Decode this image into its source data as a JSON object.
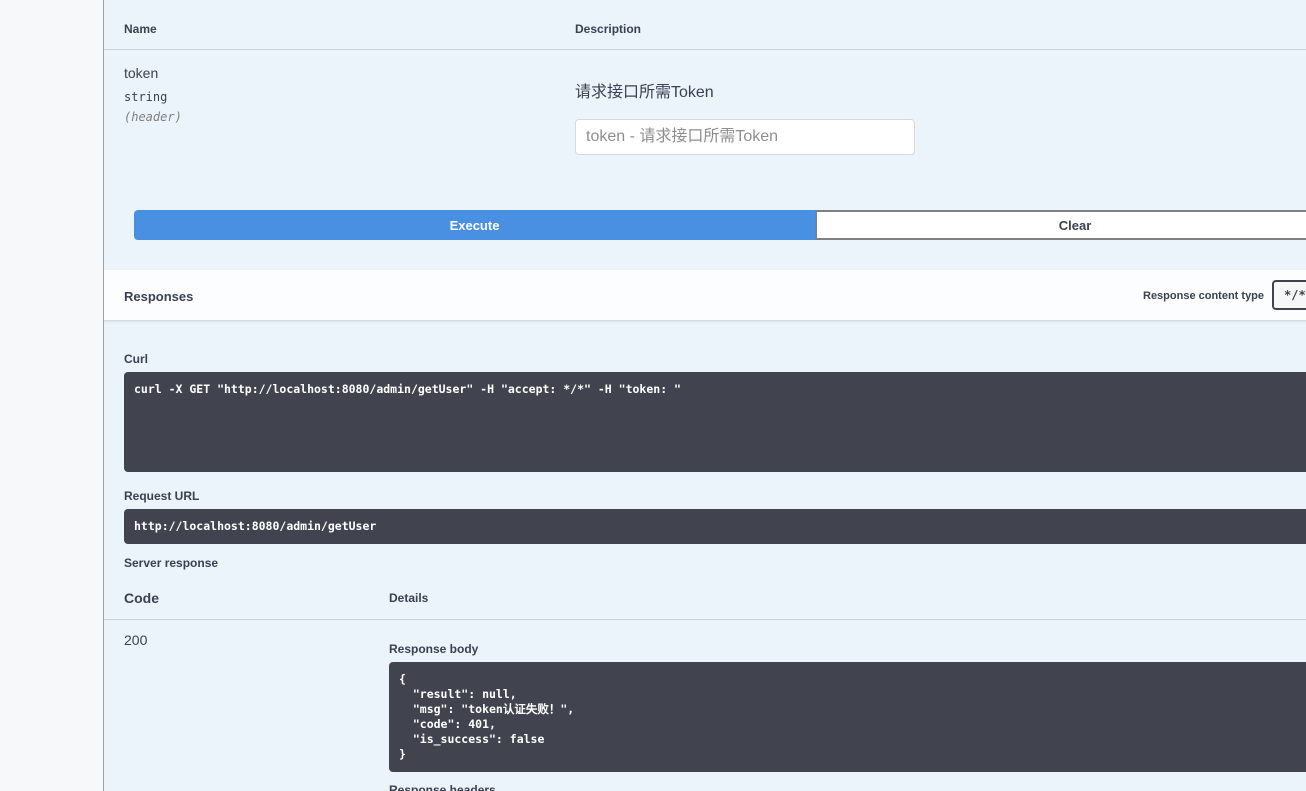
{
  "parameters": {
    "headers": {
      "name": "Name",
      "description": "Description"
    },
    "items": [
      {
        "name": "token",
        "type": "string",
        "in": "(header)",
        "description": "请求接口所需Token",
        "placeholder": "token - 请求接口所需Token",
        "value": ""
      }
    ]
  },
  "actions": {
    "execute": "Execute",
    "clear": "Clear"
  },
  "responses": {
    "title": "Responses",
    "content_type_label": "Response content type",
    "content_type_value": "*/*"
  },
  "curl": {
    "label": "Curl",
    "command": "curl -X GET \"http://localhost:8080/admin/getUser\" -H \"accept: */*\" -H \"token: \""
  },
  "request_url": {
    "label": "Request URL",
    "value": "http://localhost:8080/admin/getUser"
  },
  "server_response": {
    "label": "Server response",
    "code_header": "Code",
    "details_header": "Details",
    "code": "200",
    "body_label": "Response body",
    "body": "{\n  \"result\": null,\n  \"msg\": \"token认证失败！\",\n  \"code\": 401,\n  \"is_success\": false\n}",
    "headers_label": "Response headers"
  }
}
